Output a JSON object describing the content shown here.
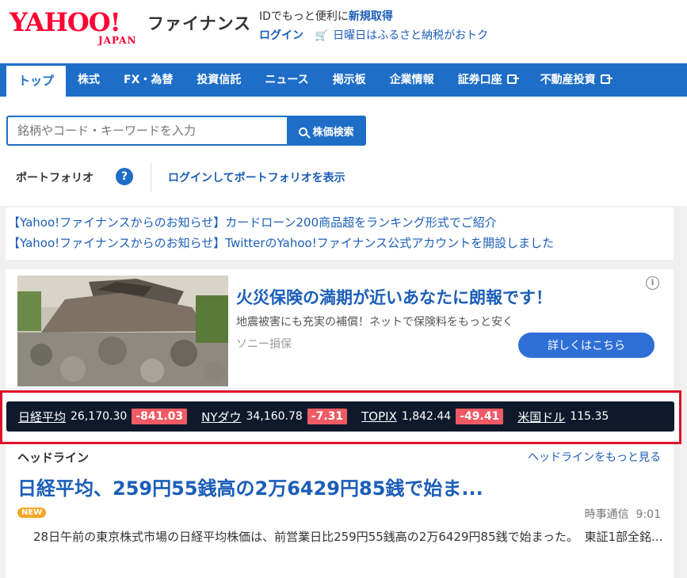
{
  "header": {
    "logo_main": "YAHOO!",
    "logo_sub": "JAPAN",
    "site_name": "ファイナンス",
    "id_text": "IDでもっと便利に",
    "signup_link": "新規取得",
    "login_link": "ログイン",
    "promo_link": "日曜日はふるさと納税がおトク"
  },
  "nav": {
    "items": [
      {
        "label": "トップ",
        "external": false,
        "active": true
      },
      {
        "label": "株式",
        "external": false
      },
      {
        "label": "FX・為替",
        "external": false
      },
      {
        "label": "投資信託",
        "external": false
      },
      {
        "label": "ニュース",
        "external": false
      },
      {
        "label": "掲示板",
        "external": false
      },
      {
        "label": "企業情報",
        "external": false
      },
      {
        "label": "証券口座",
        "external": true
      },
      {
        "label": "不動産投資",
        "external": true
      }
    ]
  },
  "search": {
    "placeholder": "銘柄やコード・キーワードを入力",
    "button_label": "株価検索"
  },
  "portfolio": {
    "label": "ポートフォリオ",
    "help": "?",
    "login_link": "ログインしてポートフォリオを表示"
  },
  "notices": [
    "【Yahoo!ファイナンスからのお知らせ】カードローン200商品超をランキング形式でご紹介",
    "【Yahoo!ファイナンスからのお知らせ】TwitterのYahoo!ファイナンス公式アカウントを開設しました"
  ],
  "ad": {
    "title": "火災保険の満期が近いあなたに朗報です！",
    "description": "地震被害にも充実の補償！ネットで保険料をもっと安く",
    "sponsor": "ソニー損保",
    "button_label": "詳しくはこちら"
  },
  "ticker": [
    {
      "name": "日経平均",
      "value": "26,170.30",
      "change": "-841.03"
    },
    {
      "name": "NYダウ",
      "value": "34,160.78",
      "change": "-7.31"
    },
    {
      "name": "TOPIX",
      "value": "1,842.44",
      "change": "-49.41"
    },
    {
      "name": "米国ドル",
      "value": "115.35",
      "change": ""
    }
  ],
  "headline": {
    "section_label": "ヘッドライン",
    "more_link": "ヘッドラインをもっと見る",
    "title": "日経平均、259円55銭高の2万6429円85銭で始ま...",
    "badge": "NEW",
    "source": "時事通信",
    "time": "9:01",
    "body": "28日午前の東京株式市場の日経平均株価は、前営業日比259円55銭高の2万6429円85銭で始まった。　東証1部全銘..."
  },
  "colors": {
    "brand_red": "#ff0033",
    "nav_blue": "#1e6ec8",
    "link_blue": "#1b5eb8",
    "ticker_bg": "#0e1a2c",
    "negative": "#f05a64",
    "highlight_frame": "#e0102a"
  }
}
